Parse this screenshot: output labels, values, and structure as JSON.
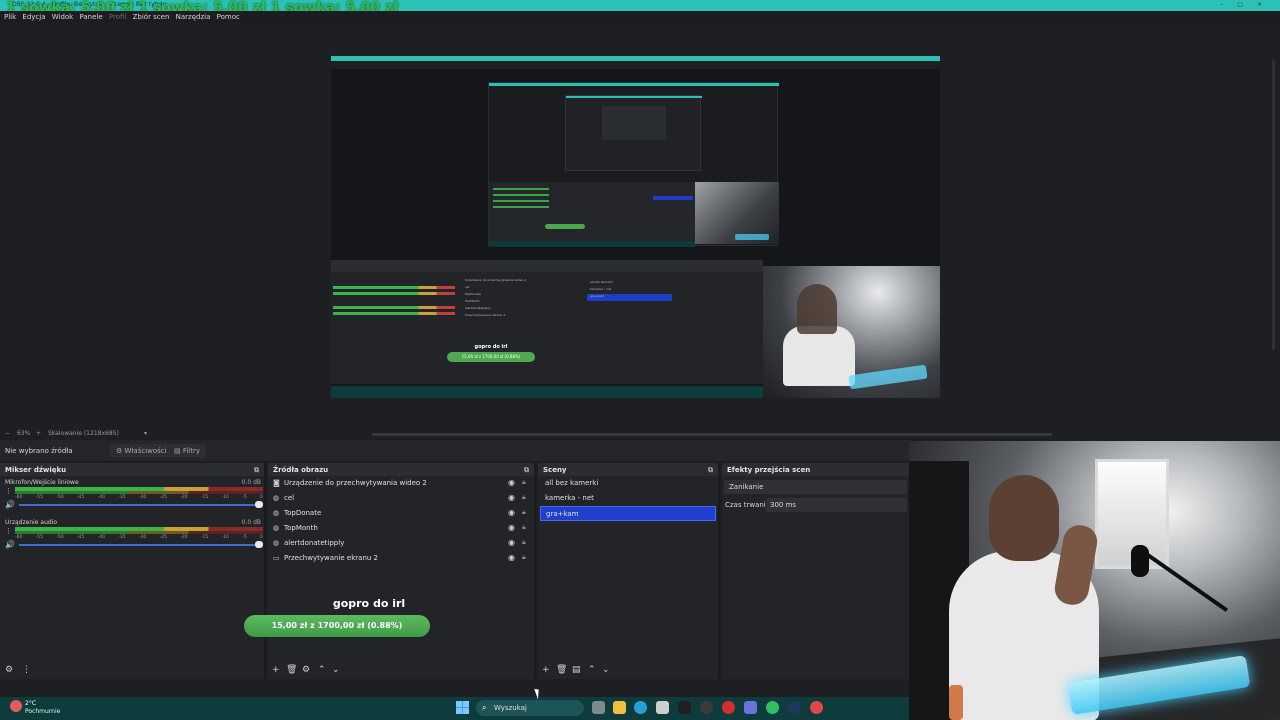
{
  "window": {
    "title": "OBS 32.0.4 - Profile: Bez tytułu - Scenes: Bez tytułu",
    "overlay_text": "1 sowka: 5,00 zł  1 sowka: 5,00 zł  1 sowka: 5,00 zł"
  },
  "menu": [
    "Plik",
    "Edycja",
    "Widok",
    "Panele",
    "Profil",
    "Zbiór scen",
    "Narzędzia",
    "Pomoc"
  ],
  "zoom": {
    "minus": "−",
    "level": "63%",
    "plus": "+",
    "mode": "Skalowanie (1218x685)",
    "dropdown": "▾"
  },
  "properties": {
    "no_source": "Nie wybrano źródła",
    "properties_btn": "Właściwości",
    "filters_btn": "Filtry"
  },
  "mixer": {
    "title": "Mikser dźwięku",
    "channels": [
      {
        "name": "Mikrofon/Wejście liniowe",
        "db": "0.0 dB"
      },
      {
        "name": "Urządzenie audio",
        "db": "0.0 dB"
      }
    ],
    "scale": [
      "-60",
      "-55",
      "-50",
      "-45",
      "-40",
      "-35",
      "-30",
      "-25",
      "-20",
      "-15",
      "-10",
      "-5",
      "0"
    ]
  },
  "sources": {
    "title": "Źródła obrazu",
    "items": [
      {
        "name": "Urządzenie do przechwytywania wideo 2",
        "icon": "camera-icon"
      },
      {
        "name": "cel",
        "icon": "globe-icon"
      },
      {
        "name": "TopDonate",
        "icon": "globe-icon"
      },
      {
        "name": "TopMonth",
        "icon": "globe-icon"
      },
      {
        "name": "alertdonatetipply",
        "icon": "globe-icon"
      },
      {
        "name": "Przechwytywanie ekranu 2",
        "icon": "monitor-icon"
      }
    ],
    "goal_title": "gopro do irl",
    "goal_progress": "15,00 zł z 1700,00 zł (0.88%)"
  },
  "scenes": {
    "title": "Sceny",
    "items": [
      "all bez kamerki",
      "kamerka - net",
      "gra+kam"
    ],
    "selected_index": 2
  },
  "transitions": {
    "title": "Efekty przejścia scen",
    "selected": "Zanikanie",
    "duration_label": "Czas trwania",
    "duration_value": "300 ms"
  },
  "preview_mini": {
    "goal_title": "gopro do irl",
    "goal_progress": "15,00 zł z 1700,00 zł (0.88%)",
    "scenes": [
      "all bez kamerki",
      "kamerka - net",
      "gra+kam"
    ]
  },
  "taskbar": {
    "temp": "2°C",
    "condition": "Pochmurnie",
    "search_placeholder": "Wyszukaj"
  },
  "colors": {
    "title_bar": "#2bc2b5",
    "selected_scene": "#1f3fcc",
    "goal_bar": "#4ea94f",
    "taskbar": "#0e3c3d"
  }
}
